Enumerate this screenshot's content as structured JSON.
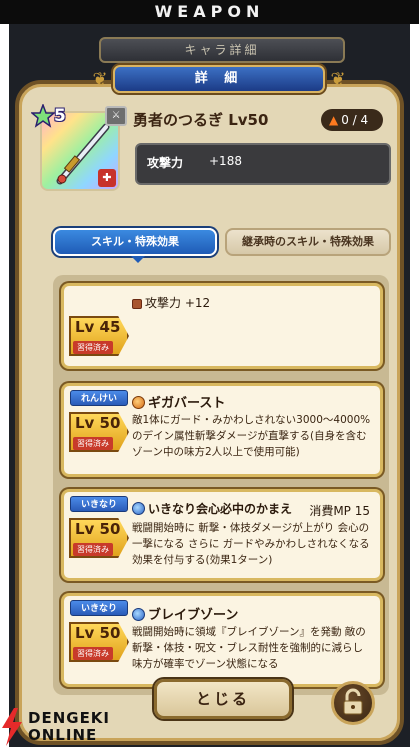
{
  "banner": {
    "title": "WEAPON"
  },
  "header": {
    "back_title": "キャラ詳細",
    "front_title": "詳 細"
  },
  "weapon": {
    "stars": "5",
    "type_icon": "sword-type-icon",
    "name": "勇者のつるぎ Lv50",
    "upgrade": "0 / 4",
    "stat_label": "攻撃力",
    "stat_value": "+188"
  },
  "tabs": [
    {
      "label": "スキル・特殊効果",
      "active": true
    },
    {
      "label": "継承時のスキル・特殊効果",
      "active": false
    }
  ],
  "skills": [
    {
      "level": "Lv 45",
      "status": "習得済み",
      "title": "攻撃力 +12",
      "icon": "attack-stat-icon"
    },
    {
      "tag": "れんけい",
      "level": "Lv 50",
      "status": "習得済み",
      "title": "ギガバースト",
      "icon": "orange-skill-icon",
      "desc": "敵1体にガード・みかわしされない3000〜4000%のデイン属性斬撃ダメージが直撃する(自身を含むゾーン中の味方2人以上で使用可能)"
    },
    {
      "tag": "いきなり",
      "level": "Lv 50",
      "status": "習得済み",
      "title": "いきなり会心必中のかまえ",
      "icon": "blue-skill-icon",
      "mp": "消費MP 15",
      "desc": "戦闘開始時に 斬撃・体技ダメージが上がり 会心の一撃になる さらに ガードやみかわしされなくなる効果を付与する(効果1ターン)"
    },
    {
      "tag": "いきなり",
      "level": "Lv 50",
      "status": "習得済み",
      "title": "ブレイブゾーン",
      "icon": "blue-skill-icon",
      "desc": "戦闘開始時に領域『ブレイブゾーン』を発動 敵の斬撃・体技・呪文・ブレス耐性を強制的に減らし味方が確率でゾーン状態になる"
    }
  ],
  "footer": {
    "close_label": "とじる",
    "lock_icon": "lock-icon"
  },
  "watermark": {
    "line1": "DENGEKI",
    "line2": "ONLINE"
  },
  "colors": {
    "accent_blue": "#2a5bb8",
    "gold": "#d8b860",
    "panel": "#e3d7b6"
  }
}
